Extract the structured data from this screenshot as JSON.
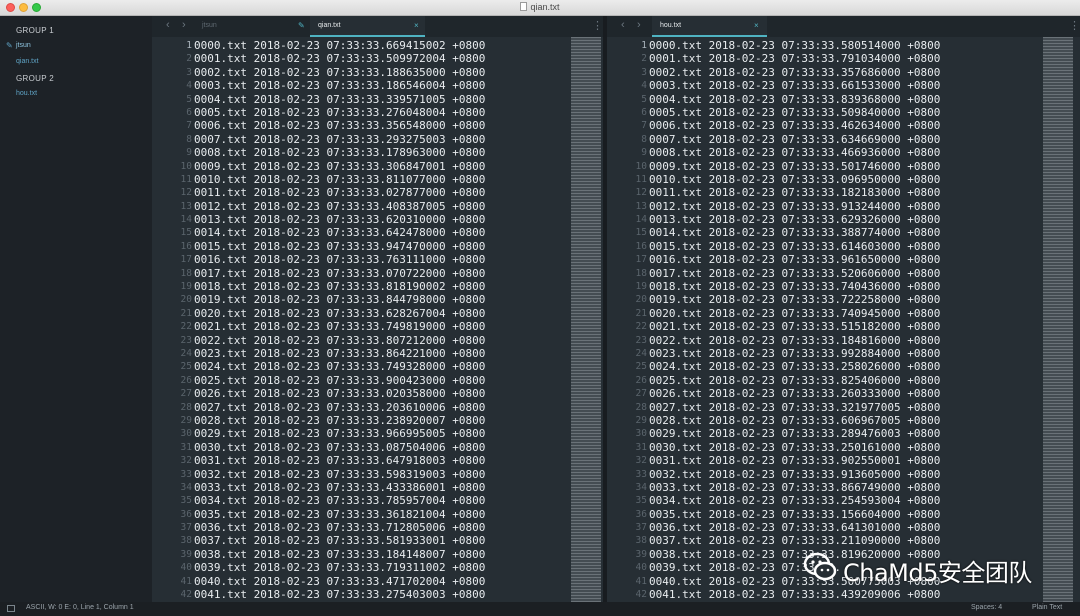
{
  "window": {
    "title": "qian.txt"
  },
  "sidebar": {
    "groups": [
      {
        "title": "GROUP 1",
        "files": [
          {
            "name": "jtsun"
          },
          {
            "name": "qian.txt"
          }
        ]
      },
      {
        "title": "GROUP 2",
        "files": [
          {
            "name": "hou.txt"
          }
        ]
      }
    ]
  },
  "left_pane": {
    "tabs": [
      {
        "label": "jtsun"
      },
      {
        "label": "qian.txt"
      }
    ],
    "tab_close_glyph": "×",
    "lines": [
      "0000.txt 2018-02-23 07:33:33.669415002 +0800",
      "0001.txt 2018-02-23 07:33:33.509972004 +0800",
      "0002.txt 2018-02-23 07:33:33.188635000 +0800",
      "0003.txt 2018-02-23 07:33:33.186546004 +0800",
      "0004.txt 2018-02-23 07:33:33.339571005 +0800",
      "0005.txt 2018-02-23 07:33:33.276048004 +0800",
      "0006.txt 2018-02-23 07:33:33.356548000 +0800",
      "0007.txt 2018-02-23 07:33:33.293275003 +0800",
      "0008.txt 2018-02-23 07:33:33.178963000 +0800",
      "0009.txt 2018-02-23 07:33:33.306847001 +0800",
      "0010.txt 2018-02-23 07:33:33.811077000 +0800",
      "0011.txt 2018-02-23 07:33:33.027877000 +0800",
      "0012.txt 2018-02-23 07:33:33.408387005 +0800",
      "0013.txt 2018-02-23 07:33:33.620310000 +0800",
      "0014.txt 2018-02-23 07:33:33.642478000 +0800",
      "0015.txt 2018-02-23 07:33:33.947470000 +0800",
      "0016.txt 2018-02-23 07:33:33.763111000 +0800",
      "0017.txt 2018-02-23 07:33:33.070722000 +0800",
      "0018.txt 2018-02-23 07:33:33.818190002 +0800",
      "0019.txt 2018-02-23 07:33:33.844798000 +0800",
      "0020.txt 2018-02-23 07:33:33.628267004 +0800",
      "0021.txt 2018-02-23 07:33:33.749819000 +0800",
      "0022.txt 2018-02-23 07:33:33.807212000 +0800",
      "0023.txt 2018-02-23 07:33:33.864221000 +0800",
      "0024.txt 2018-02-23 07:33:33.749328000 +0800",
      "0025.txt 2018-02-23 07:33:33.900423000 +0800",
      "0026.txt 2018-02-23 07:33:33.020358000 +0800",
      "0027.txt 2018-02-23 07:33:33.203610006 +0800",
      "0028.txt 2018-02-23 07:33:33.238920007 +0800",
      "0029.txt 2018-02-23 07:33:33.966995005 +0800",
      "0030.txt 2018-02-23 07:33:33.087504006 +0800",
      "0031.txt 2018-02-23 07:33:33.647918003 +0800",
      "0032.txt 2018-02-23 07:33:33.598319003 +0800",
      "0033.txt 2018-02-23 07:33:33.433386001 +0800",
      "0034.txt 2018-02-23 07:33:33.785957004 +0800",
      "0035.txt 2018-02-23 07:33:33.361821004 +0800",
      "0036.txt 2018-02-23 07:33:33.712805006 +0800",
      "0037.txt 2018-02-23 07:33:33.581933001 +0800",
      "0038.txt 2018-02-23 07:33:33.184148007 +0800",
      "0039.txt 2018-02-23 07:33:33.719311002 +0800",
      "0040.txt 2018-02-23 07:33:33.471702004 +0800",
      "0041.txt 2018-02-23 07:33:33.275403003 +0800"
    ]
  },
  "right_pane": {
    "tabs": [
      {
        "label": "hou.txt"
      }
    ],
    "tab_close_glyph": "×",
    "lines": [
      "0000.txt 2018-02-23 07:33:33.580514000 +0800",
      "0001.txt 2018-02-23 07:33:33.791034000 +0800",
      "0002.txt 2018-02-23 07:33:33.357686000 +0800",
      "0003.txt 2018-02-23 07:33:33.661533000 +0800",
      "0004.txt 2018-02-23 07:33:33.839368000 +0800",
      "0005.txt 2018-02-23 07:33:33.509840000 +0800",
      "0006.txt 2018-02-23 07:33:33.462634000 +0800",
      "0007.txt 2018-02-23 07:33:33.634669000 +0800",
      "0008.txt 2018-02-23 07:33:33.466936000 +0800",
      "0009.txt 2018-02-23 07:33:33.501746000 +0800",
      "0010.txt 2018-02-23 07:33:33.096950000 +0800",
      "0011.txt 2018-02-23 07:33:33.182183000 +0800",
      "0012.txt 2018-02-23 07:33:33.913244000 +0800",
      "0013.txt 2018-02-23 07:33:33.629326000 +0800",
      "0014.txt 2018-02-23 07:33:33.388774000 +0800",
      "0015.txt 2018-02-23 07:33:33.614603000 +0800",
      "0016.txt 2018-02-23 07:33:33.961650000 +0800",
      "0017.txt 2018-02-23 07:33:33.520606000 +0800",
      "0018.txt 2018-02-23 07:33:33.740436000 +0800",
      "0019.txt 2018-02-23 07:33:33.722258000 +0800",
      "0020.txt 2018-02-23 07:33:33.740945000 +0800",
      "0021.txt 2018-02-23 07:33:33.515182000 +0800",
      "0022.txt 2018-02-23 07:33:33.184816000 +0800",
      "0023.txt 2018-02-23 07:33:33.992884000 +0800",
      "0024.txt 2018-02-23 07:33:33.258026000 +0800",
      "0025.txt 2018-02-23 07:33:33.825406000 +0800",
      "0026.txt 2018-02-23 07:33:33.260333000 +0800",
      "0027.txt 2018-02-23 07:33:33.321977005 +0800",
      "0028.txt 2018-02-23 07:33:33.606967005 +0800",
      "0029.txt 2018-02-23 07:33:33.289476003 +0800",
      "0030.txt 2018-02-23 07:33:33.250161000 +0800",
      "0031.txt 2018-02-23 07:33:33.902550001 +0800",
      "0032.txt 2018-02-23 07:33:33.913605000 +0800",
      "0033.txt 2018-02-23 07:33:33.866749000 +0800",
      "0034.txt 2018-02-23 07:33:33.254593004 +0800",
      "0035.txt 2018-02-23 07:33:33.156604000 +0800",
      "0036.txt 2018-02-23 07:33:33.641301000 +0800",
      "0037.txt 2018-02-23 07:33:33.211090000 +0800",
      "0038.txt 2018-02-23 07:33:33.819620000 +0800",
      "0039.txt 2018-02-23 07:33:33.",
      "0040.txt 2018-02-23 07:33:33.500775003 +0800",
      "0041.txt 2018-02-23 07:33:33.439209006 +0800"
    ]
  },
  "statusbar": {
    "left_text": "ASCII, W: 0 E: 0, Line 1, Column 1",
    "spaces": "Spaces: 4",
    "syntax": "Plain Text"
  },
  "watermark": {
    "text": "ChaMd5安全团队"
  },
  "colors": {
    "accent": "#4fb3c2",
    "editor_bg": "#262e34",
    "sidebar_bg": "#1d2227",
    "text": "#e8ecef"
  },
  "icons": {
    "back": "chevron-left-icon",
    "forward": "chevron-right-icon",
    "edit": "pencil-icon",
    "menu": "kebab-menu-icon",
    "close": "close-icon",
    "status": "panel-icon",
    "watermark": "wechat-icon"
  }
}
